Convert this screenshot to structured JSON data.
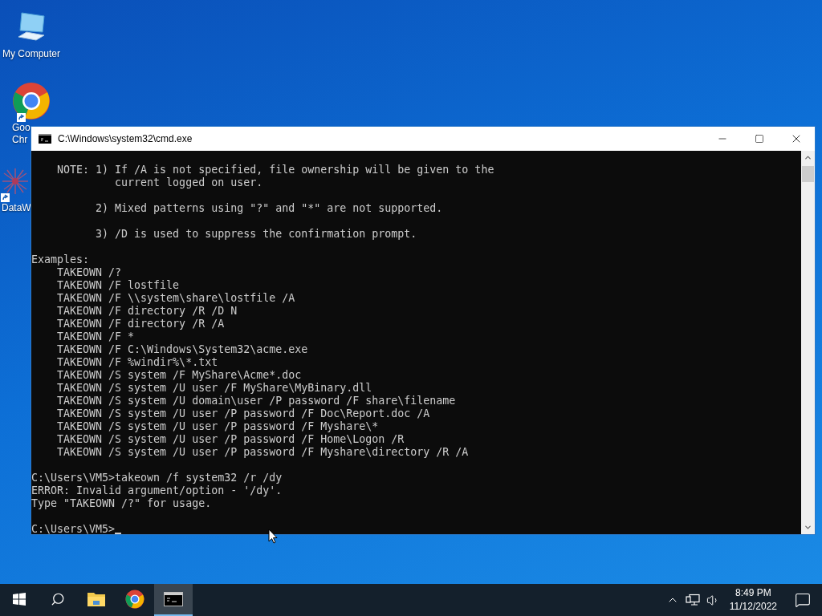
{
  "desktop": {
    "icons": [
      {
        "kind": "computer",
        "shortcut": false,
        "label_lines": [
          "My Computer"
        ]
      },
      {
        "kind": "chrome",
        "shortcut": true,
        "label_lines": [
          "Goo",
          "Chr"
        ]
      },
      {
        "kind": "network",
        "shortcut": true,
        "label_lines": [
          "DataW"
        ]
      }
    ]
  },
  "window": {
    "title": "C:\\Windows\\system32\\cmd.exe",
    "console": {
      "cursor": true,
      "blocks": [
        [
          "    NOTE: 1) If /A is not specified, file ownership will be given to the",
          "             current logged on user."
        ],
        [
          "          2) Mixed patterns using \"?\" and \"*\" are not supported."
        ],
        [
          "          3) /D is used to suppress the confirmation prompt."
        ],
        [
          "Examples:",
          "    TAKEOWN /?",
          "    TAKEOWN /F lostfile",
          "    TAKEOWN /F \\\\system\\share\\lostfile /A",
          "    TAKEOWN /F directory /R /D N",
          "    TAKEOWN /F directory /R /A",
          "    TAKEOWN /F *",
          "    TAKEOWN /F C:\\Windows\\System32\\acme.exe",
          "    TAKEOWN /F %windir%\\*.txt",
          "    TAKEOWN /S system /F MyShare\\Acme*.doc",
          "    TAKEOWN /S system /U user /F MyShare\\MyBinary.dll",
          "    TAKEOWN /S system /U domain\\user /P password /F share\\filename",
          "    TAKEOWN /S system /U user /P password /F Doc\\Report.doc /A",
          "    TAKEOWN /S system /U user /P password /F Myshare\\*",
          "    TAKEOWN /S system /U user /P password /F Home\\Logon /R",
          "    TAKEOWN /S system /U user /P password /F Myshare\\directory /R /A"
        ],
        [
          "C:\\Users\\VM5>takeown /f system32 /r /dy",
          "ERROR: Invalid argument/option - '/dy'.",
          "Type \"TAKEOWN /?\" for usage."
        ],
        [
          "C:\\Users\\VM5>"
        ]
      ]
    }
  },
  "taskbar": {
    "apps": [
      {
        "kind": "explorer",
        "active": false
      },
      {
        "kind": "chrome",
        "active": false
      },
      {
        "kind": "console",
        "active": true
      }
    ],
    "clock": {
      "time": "8:49 PM",
      "date": "11/12/2022"
    }
  }
}
